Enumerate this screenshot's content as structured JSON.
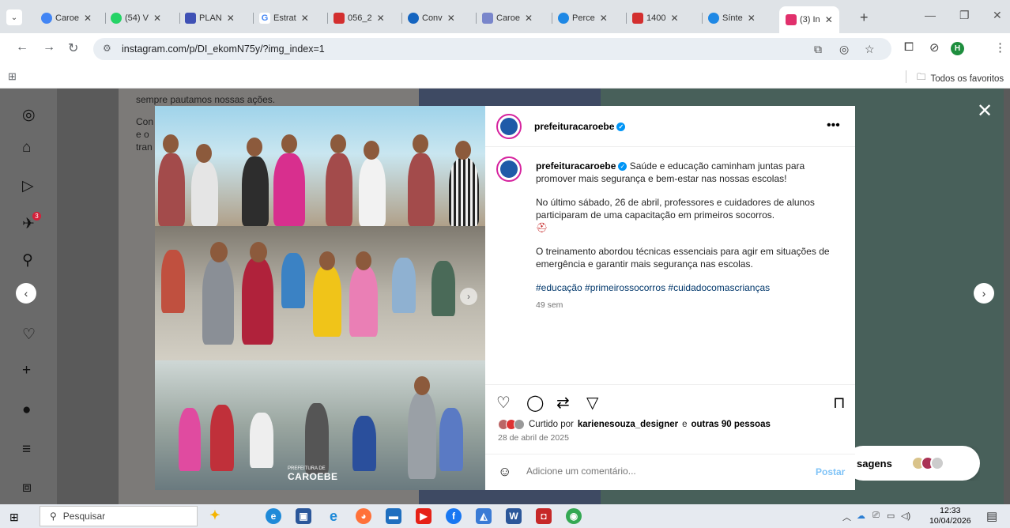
{
  "browser": {
    "tabs": [
      {
        "label": "Caroe",
        "color": "#4285f4"
      },
      {
        "label": "(54) V",
        "color": "#25d366"
      },
      {
        "label": "PLAN",
        "color": "#3f51b5"
      },
      {
        "label": "Estrat",
        "color": "#4285f4"
      },
      {
        "label": "056_2",
        "color": "#d32f2f"
      },
      {
        "label": "Conv",
        "color": "#1565c0"
      },
      {
        "label": "Caroe",
        "color": "#7986cb"
      },
      {
        "label": "Perce",
        "color": "#1e88e5"
      },
      {
        "label": "1400",
        "color": "#d32f2f"
      },
      {
        "label": "Sínte",
        "color": "#1e88e5"
      }
    ],
    "active_tab": {
      "label": "(3) In",
      "color": "#e1306c"
    },
    "url": "instagram.com/p/DI_ekomN75y/?img_index=1",
    "profile_initial": "H",
    "bookmarks_all": "Todos os favoritos"
  },
  "background": {
    "text_line1": "sempre pautamos nossas ações.",
    "text_line2": "Con",
    "text_line3": "e o",
    "text_line4": "tran"
  },
  "sidebar": {
    "notification_count": "3"
  },
  "post": {
    "username": "prefeituracaroebe",
    "caption_intro": "Saúde e educação caminham juntas para promover mais segurança e bem-estar nas nossas escolas!",
    "caption_p2": "No último sábado, 26 de abril, professores e cuidadores de alunos participaram de uma capacitação em primeiros socorros.",
    "caption_p3": "O treinamento abordou técnicas essenciais para agir em situações de emergência e garantir mais segurança nas escolas.",
    "hashtags": "#educação #primeirossocorros #cuidadocomascrianças",
    "age": "49 sem",
    "liked_by_prefix": "Curtido por",
    "liked_by_user": "karienesouza_designer",
    "liked_by_connector": "e",
    "liked_by_others": "outras 90 pessoas",
    "date": "28 de abril de 2025",
    "comment_placeholder": "Adicione um comentário...",
    "post_button": "Postar",
    "photo_logo_small": "PREFEITURA DE",
    "photo_logo": "CAROEBE"
  },
  "messages": {
    "label": "sagens"
  },
  "taskbar": {
    "search_placeholder": "Pesquisar",
    "time": "12:33",
    "date": "10/04/2026"
  }
}
